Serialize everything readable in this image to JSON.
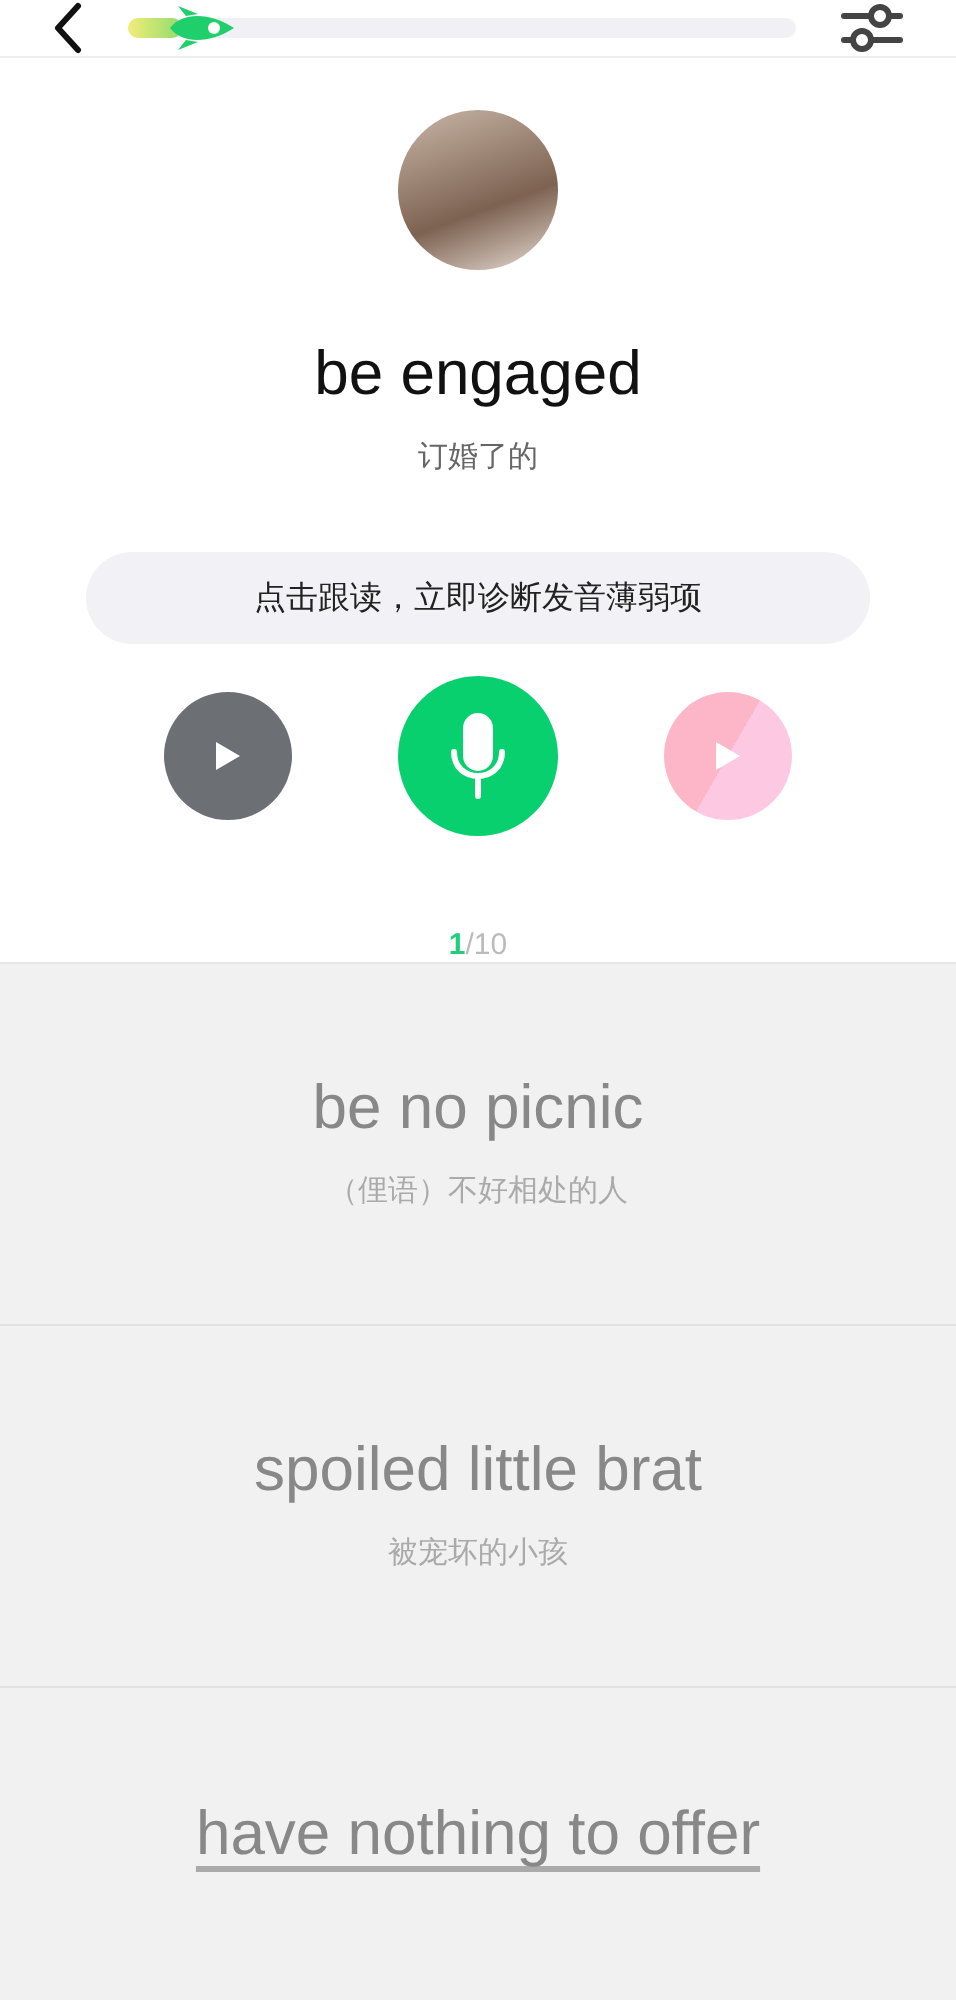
{
  "progress": {
    "level": 0.08
  },
  "current": {
    "phrase": "be engaged",
    "translation": "订婚了的"
  },
  "hint": "点击跟读，立即诊断发音薄弱项",
  "counter": {
    "current": "1",
    "total": "/10"
  },
  "cards": [
    {
      "phrase": "be no picnic",
      "translation": "（俚语）不好相处的人",
      "kind": "full"
    },
    {
      "phrase": "spoiled little brat",
      "translation": "被宠坏的小孩",
      "kind": "full"
    },
    {
      "phrase": "have nothing to offer",
      "kind": "underlined"
    }
  ]
}
